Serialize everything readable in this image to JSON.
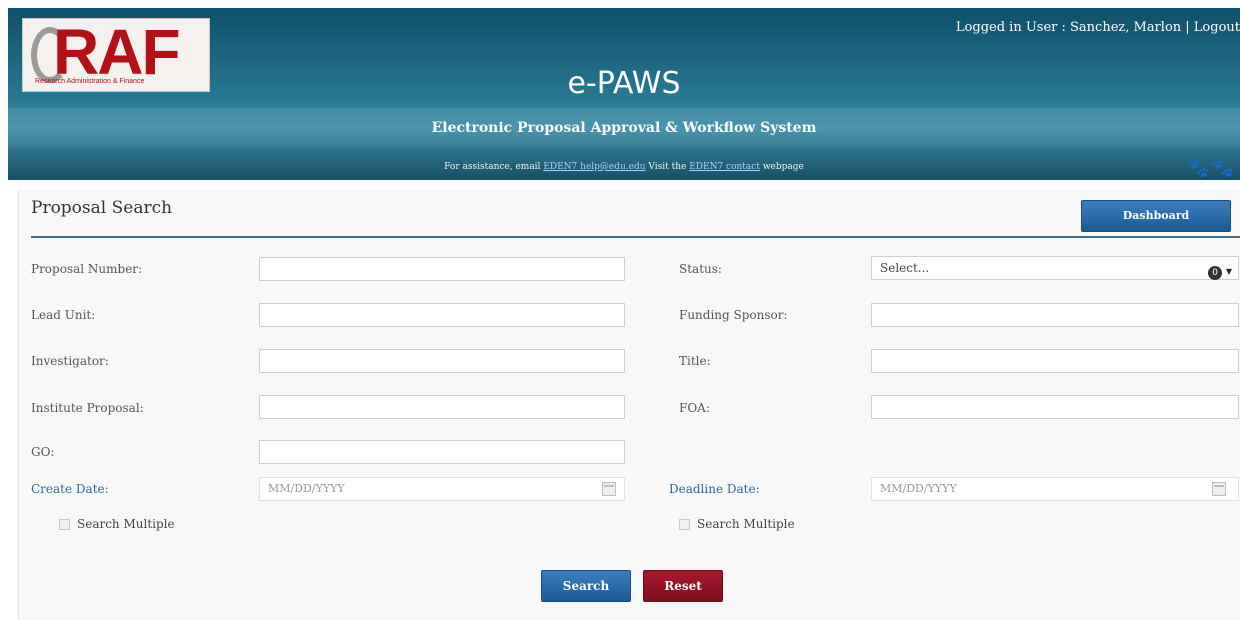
{
  "header": {
    "logo_text": "RAF",
    "logo_tagline": "Research Administration & Finance",
    "user_info": "Logged in User : Sanchez, Marlon | Logout",
    "app_title": "e-PAWS",
    "app_subtitle": "Electronic Proposal Approval & Workflow System",
    "assist_prefix": "For assistance, email",
    "assist_email": "EDEN7 help@edu.edu",
    "assist_mid": "Visit the",
    "assist_link": "EDEN7 contact",
    "assist_suffix": "webpage",
    "paws_icon": "paw-prints"
  },
  "panel": {
    "title": "Proposal Search",
    "dashboard_label": "Dashboard"
  },
  "form": {
    "proposal_number_label": "Proposal Number:",
    "lead_unit_label": "Lead Unit:",
    "investigator_label": "Investigator:",
    "institute_proposal_label": "Institute Proposal:",
    "go_label": "GO:",
    "create_date_label": "Create Date:",
    "create_date_placeholder": "MM/DD/YYYY",
    "status_label": "Status:",
    "status_value": "Select...",
    "funding_sponsor_label": "Funding Sponsor:",
    "title_label": "Title:",
    "foa_label": "FOA:",
    "deadline_date_label": "Deadline Date:",
    "deadline_date_placeholder": "MM/DD/YYYY",
    "search_multiple_label": "Search Multiple",
    "search_multiple_label_2": "Search Multiple",
    "clear_glyph": "0",
    "dropdown_glyph": "▾"
  },
  "actions": {
    "search_label": "Search",
    "reset_label": "Reset"
  },
  "colors": {
    "header_teal": "#2a7a94",
    "primary_button": "#1d5a96",
    "reset_button": "#7d0f1f",
    "date_label_blue": "#2a6a9a"
  }
}
